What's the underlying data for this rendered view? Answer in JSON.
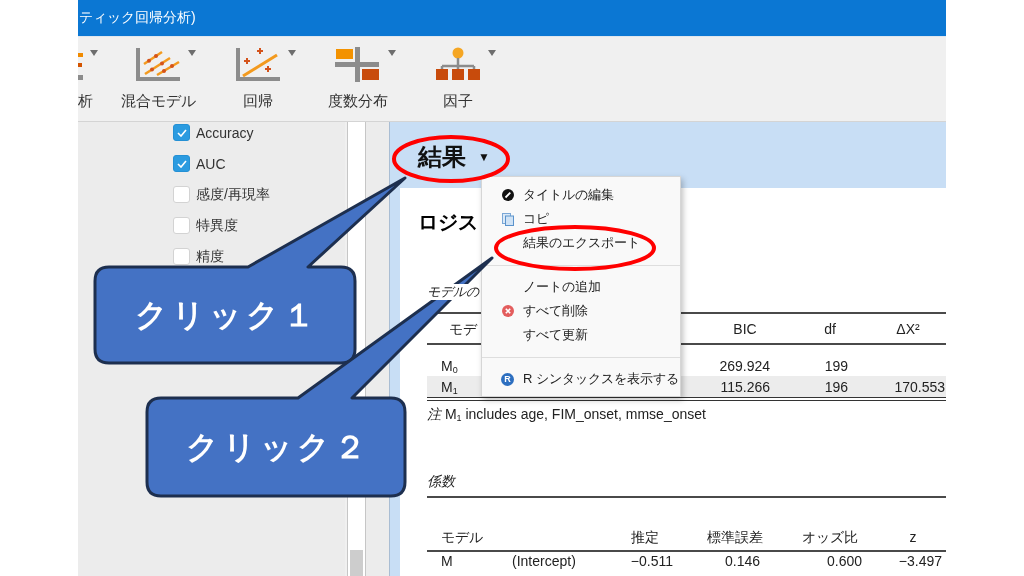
{
  "window": {
    "title": "ティック回帰分析)"
  },
  "toolbar": [
    {
      "label": "析",
      "kind": "partial"
    },
    {
      "label": "混合モデル",
      "kind": "mixed"
    },
    {
      "label": "回帰",
      "kind": "regression"
    },
    {
      "label": "度数分布",
      "kind": "frequencies"
    },
    {
      "label": "因子",
      "kind": "factor"
    }
  ],
  "options": [
    {
      "label": "Accuracy",
      "checked": true
    },
    {
      "label": "AUC",
      "checked": true
    },
    {
      "label": "感度/再現率",
      "checked": false
    },
    {
      "label": "特異度",
      "checked": false
    },
    {
      "label": "精度",
      "checked": false
    }
  ],
  "results": {
    "heading": "結果",
    "heading_caret": "▼",
    "title": "ロジス",
    "model_summary": {
      "title": "モデルの",
      "columns": [
        {
          "label": "モデ"
        },
        {
          "label": "BIC"
        },
        {
          "label": "df"
        },
        {
          "label": "ΔX²"
        }
      ],
      "rows": [
        {
          "cells": [
            "M$_{0}$",
            "269.924",
            "199"
          ],
          "highlighted": false
        },
        {
          "cells": [
            "M$_{1}$",
            "115.266",
            "196",
            "170.553"
          ],
          "highlighted": true
        }
      ],
      "note": "*注* M$_{1}$ includes age, FIM_onset, mmse_onset"
    },
    "coefficients": {
      "title": "係数",
      "columns": [
        {
          "label": "モデル"
        },
        {},
        {
          "label": "推定"
        },
        {
          "label": "標準誤差"
        },
        {
          "label": "オッズ比"
        },
        {
          "label": "z"
        }
      ],
      "rows": [
        {
          "cells": [
            "M",
            "(Intercept)",
            "−0.511",
            "0.146",
            "0.600",
            "−3.497"
          ]
        }
      ]
    }
  },
  "context_menu": {
    "groups": [
      [
        {
          "label": "タイトルの編集",
          "kind": "edit"
        },
        {
          "label": "コピ",
          "kind": "copy"
        },
        {
          "label": "結果のエクスポート",
          "kind": "plain"
        }
      ],
      [
        {
          "label": "ノートの追加",
          "kind": "plain"
        },
        {
          "label": "すべて削除",
          "kind": "delete"
        },
        {
          "label": "すべて更新",
          "kind": "plain"
        }
      ],
      [
        {
          "label": "R シンタックスを表示する",
          "kind": "r",
          "badge": "R"
        }
      ]
    ]
  },
  "callouts": [
    {
      "text": "クリック１"
    },
    {
      "text": "クリック２"
    }
  ]
}
